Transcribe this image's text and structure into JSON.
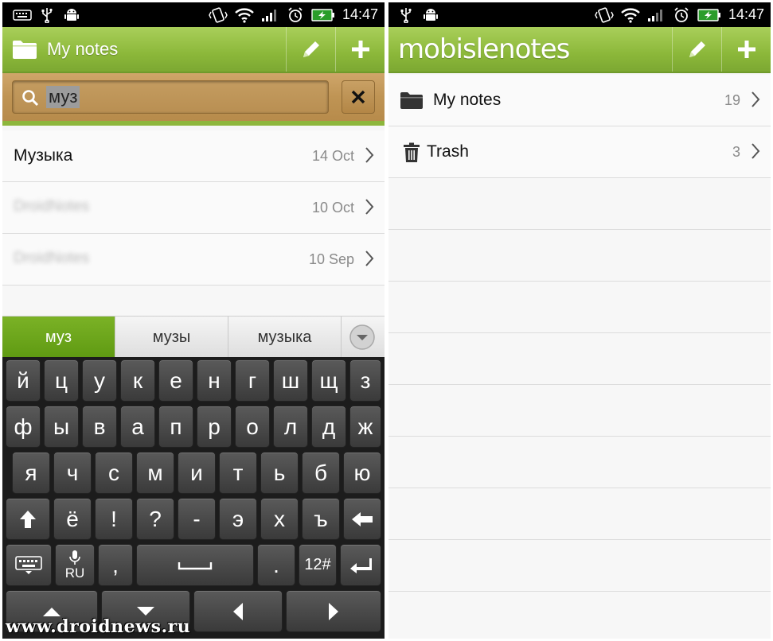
{
  "left": {
    "status": {
      "time": "14:47"
    },
    "header": {
      "title": "My notes"
    },
    "search": {
      "query": "муз"
    },
    "results": [
      {
        "title": "Музыка",
        "date": "14 Oct",
        "blurred": false
      },
      {
        "title": "DroidNotes",
        "date": "10 Oct",
        "blurred": true
      },
      {
        "title": "DroidNotes",
        "date": "10 Sep",
        "blurred": true
      }
    ],
    "suggestions": [
      "муз",
      "музы",
      "музыка"
    ],
    "keyboard": {
      "row1": [
        "й",
        "ц",
        "у",
        "к",
        "е",
        "н",
        "г",
        "ш",
        "щ",
        "з"
      ],
      "row2": [
        "ф",
        "ы",
        "в",
        "а",
        "п",
        "р",
        "о",
        "л",
        "д",
        "ж"
      ],
      "row3": [
        "я",
        "ч",
        "с",
        "м",
        "и",
        "т",
        "ь",
        "б",
        "ю"
      ],
      "row4": [
        "ё",
        "!",
        "?",
        "-",
        "э",
        "х",
        "ъ"
      ],
      "lang_label": "RU",
      "comma": ",",
      "period": ".",
      "symbols_label": "12#"
    }
  },
  "right": {
    "status": {
      "time": "14:47"
    },
    "header": {
      "brand": "mobislenotes"
    },
    "folders": [
      {
        "name": "My notes",
        "count": "19",
        "icon": "folder-icon"
      },
      {
        "name": "Trash",
        "count": "3",
        "icon": "trash-icon"
      }
    ]
  },
  "watermark": "www.droidnews.ru",
  "colors": {
    "accent": "#8cb83a",
    "search_bg": "#bf9454",
    "keyboard_bg": "#1c1c1c",
    "suggest_active": "#6aa31a"
  }
}
